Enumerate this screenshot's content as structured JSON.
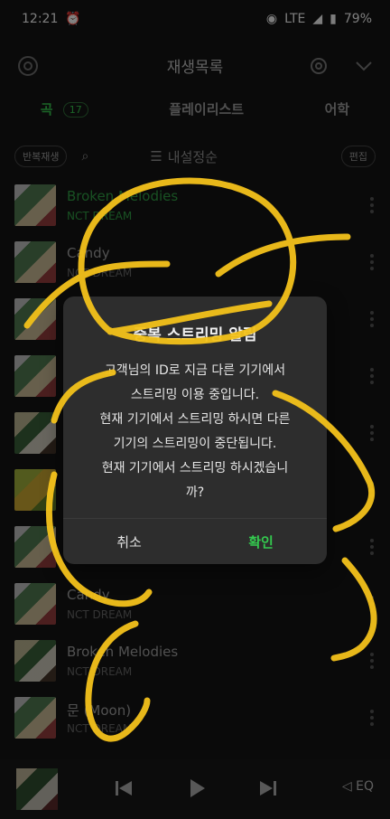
{
  "status": {
    "time": "12:21",
    "network": "LTE",
    "battery": "79%"
  },
  "header": {
    "title": "재생목록"
  },
  "tabs": [
    {
      "label": "곡",
      "count": "17"
    },
    {
      "label": "플레이리스트"
    },
    {
      "label": "어학"
    }
  ],
  "toolbar": {
    "repeat_label": "반복재생",
    "sort_label": "내설정순",
    "edit_label": "편집"
  },
  "songs": [
    {
      "title": "Broken Melodies",
      "artist": "NCT DREAM"
    },
    {
      "title": "Candy",
      "artist": "NCT DREAM"
    },
    {
      "title": "",
      "artist": ""
    },
    {
      "title": "",
      "artist": ""
    },
    {
      "title": "",
      "artist": ""
    },
    {
      "title": "",
      "artist": ""
    },
    {
      "title": "",
      "artist": ""
    },
    {
      "title": "Candy",
      "artist": "NCT DREAM"
    },
    {
      "title": "Broken Melodies",
      "artist": "NCT DREAM"
    },
    {
      "title": "문 (Moon)",
      "artist": "NCT DREAM"
    }
  ],
  "dialog": {
    "title": "중복 스트리밍 알림",
    "body": "고객님의 ID로 지금 다른 기기에서\n스트리밍 이용 중입니다.\n현재 기기에서 스트리밍 하시면 다른\n기기의 스트리밍이 중단됩니다.\n현재 기기에서 스트리밍 하시겠습니\n까?",
    "cancel": "취소",
    "confirm": "확인"
  },
  "player": {
    "eq_label": "EQ"
  },
  "colors": {
    "accent": "#35c24b",
    "scribble": "#f4c21b"
  },
  "icons": [
    "airplay-icon",
    "gear-icon",
    "chevron-down-icon",
    "search-icon",
    "sort-icon",
    "more-icon",
    "previous-icon",
    "play-icon",
    "next-icon",
    "equalizer-icon"
  ]
}
